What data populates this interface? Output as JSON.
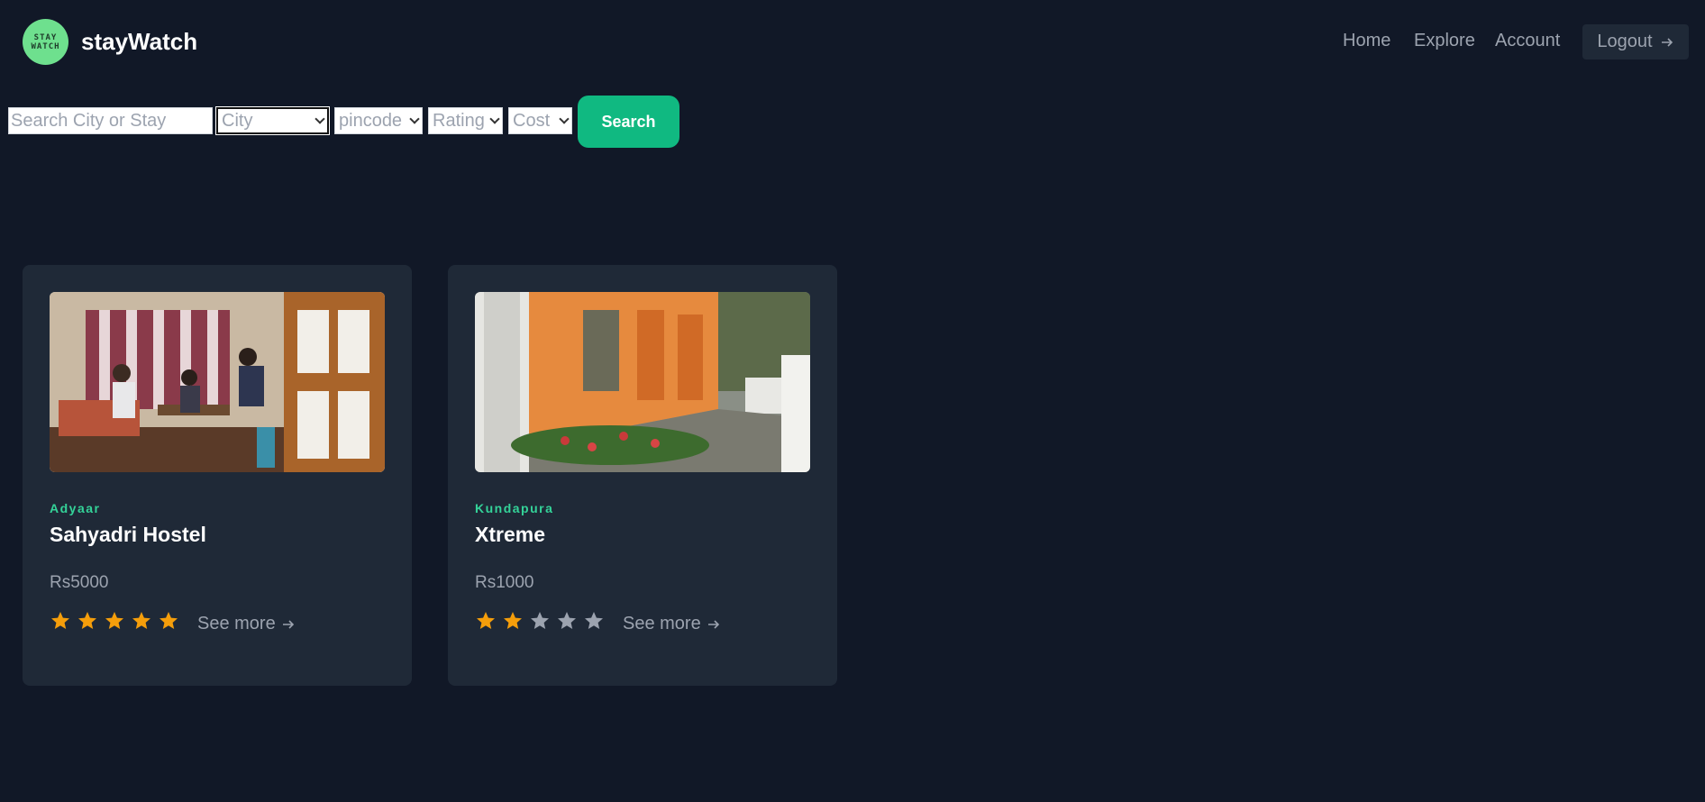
{
  "header": {
    "logo_text_line1": "STAY",
    "logo_text_line2": "WATCH",
    "brand": "stayWatch",
    "nav": {
      "home": "Home",
      "explore": "Explore",
      "account": "Account",
      "logout": "Logout"
    }
  },
  "search": {
    "input_placeholder": "Search City or Stay",
    "city_select": "City",
    "pincode_select": "pincode",
    "rating_select": "Rating",
    "cost_select": "Cost",
    "button_label": "Search"
  },
  "colors": {
    "accent": "#10b981",
    "city_label": "#34d399",
    "star_filled": "#f59e0b",
    "star_empty": "#9ca3af",
    "background": "#111827",
    "card": "#1f2937"
  },
  "cards": [
    {
      "city": "Adyaar",
      "name": "Sahyadri Hostel",
      "price": "Rs5000",
      "rating": 5,
      "see_more": "See more"
    },
    {
      "city": "Kundapura",
      "name": "Xtreme",
      "price": "Rs1000",
      "rating": 2,
      "see_more": "See more"
    }
  ],
  "rating_max": 5
}
